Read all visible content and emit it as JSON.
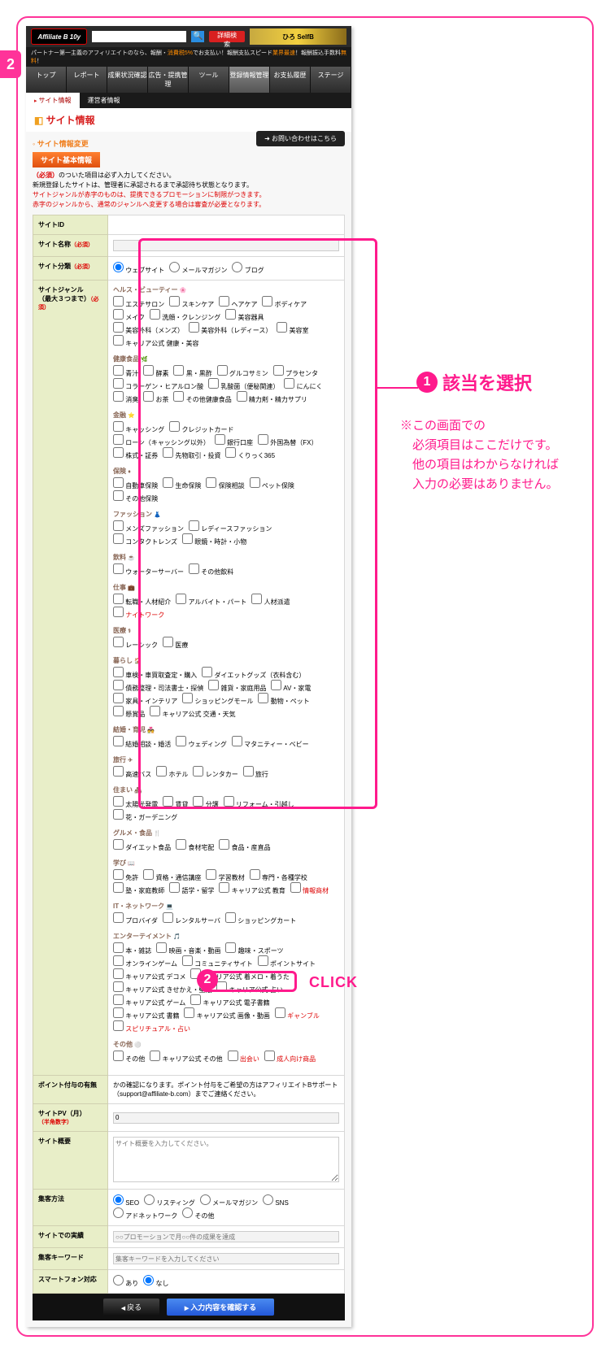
{
  "step_number": "2",
  "logo": "Affiliate B 10y",
  "tagline_plain": "パートナー第一主義のアフィリエイトのなら、報酬・",
  "tagline_highlight": "消費税5%",
  "tagline_plain2": "でお支払い！報酬支払スピード",
  "tagline_highlight2": "業界最速",
  "tagline_plain3": "！報酬振込手数料",
  "tagline_highlight3": "無料",
  "tagline_plain4": "！",
  "search_button": "詳細検索",
  "banner_text": "ひろ SelfB",
  "menu": [
    "トップ",
    "レポート",
    "成果状況確認",
    "広告・提携管理",
    "ツール",
    "登録情報管理",
    "お支払履歴",
    "ステージ"
  ],
  "sub_tabs": [
    "サイト情報",
    "運営者情報"
  ],
  "page_title": "サイト情報",
  "section_title": "サイト情報変更",
  "orange_bar": "サイト基本情報",
  "contact_btn": "お問い合わせはこちら",
  "notice_line1a": "（必須）",
  "notice_line1b": "のついた項目は必ず入力してください。",
  "notice_line2": "新規登録したサイトは、管理者に承認されるまで承認待ち状態となります。",
  "notice_line3": "サイトジャンルが赤字のものは、提携できるプロモーションに制限がつきます。",
  "notice_line4": "赤字のジャンルから、通常のジャンルへ変更する場合は審査が必要となります。",
  "rows": {
    "site_id": "サイトID",
    "site_name": "サイト名称",
    "site_type": "サイト分類",
    "site_genre": "サイトジャンル",
    "site_genre_sub": "（最大３つまで）",
    "point_grant": "ポイント付与の有無",
    "site_pv": "サイトPV（月）",
    "site_pv_sub": "（半角数字）",
    "site_summary": "サイト概要",
    "gather": "集客方法",
    "performance": "サイトでの実績",
    "keywords": "集客キーワード",
    "smartphone": "スマートフォン対応"
  },
  "required": "（必須）",
  "site_type_opts": [
    "ウェブサイト",
    "メールマガジン",
    "ブログ"
  ],
  "categories": [
    {
      "name": "ヘルス・ビューティー",
      "star": "🌸",
      "items": [
        "エステサロン",
        "スキンケア",
        "ヘアケア",
        "ボディケア",
        "メイク",
        "洗顔・クレンジング",
        "美容器具",
        "美容外科（メンズ）",
        "美容外科（レディース）",
        "美容室",
        "キャリア公式 健康・美容"
      ]
    },
    {
      "name": "健康食品",
      "star": "🌿",
      "items": [
        "青汁",
        "酵素",
        "黒・黒酢",
        "グルコサミン",
        "プラセンタ",
        "コラーゲン・ヒアルロン酸",
        "乳酸菌（便秘関連）",
        "にんにく",
        "消臭",
        "お茶",
        "その他健康食品",
        "精力剤・精力サプリ"
      ]
    },
    {
      "name": "金融",
      "star": "⭐",
      "items": [
        "キャッシング",
        "クレジットカード",
        "ローン（キャッシング以外）",
        "銀行口座",
        "外国為替（FX）",
        "株式・証券",
        "先物取引・投資",
        "くりっく365"
      ]
    },
    {
      "name": "保険",
      "star": "♦",
      "items": [
        "自動車保険",
        "生命保険",
        "保険相談",
        "ペット保険",
        "その他保険"
      ]
    },
    {
      "name": "ファッション",
      "star": "👗",
      "items": [
        "メンズファッション",
        "レディースファッション",
        "コンタクトレンズ",
        "眼鏡・時計・小物"
      ]
    },
    {
      "name": "飲料",
      "star": "☕",
      "items": [
        "ウォーターサーバー",
        "その他飲料"
      ]
    },
    {
      "name": "仕事",
      "star": "💼",
      "items": [
        "転職・人材紹介",
        "アルバイト・パート",
        "人材派遣"
      ],
      "red_items": [
        "ナイトワーク"
      ]
    },
    {
      "name": "医療",
      "star": "⚕",
      "items": [
        "レーシック",
        "医療"
      ]
    },
    {
      "name": "暮らし",
      "star": "🏠",
      "items": [
        "車検・車買取査定・購入",
        "ダイエットグッズ（衣料含む）",
        "債務整理・司法書士・探偵",
        "雑貨・家庭用品",
        "AV・家電",
        "家具・インテリア",
        "ショッピングモール",
        "動物・ペット",
        "懸賞品",
        "キャリア公式 交通・天気"
      ]
    },
    {
      "name": "結婚・育児",
      "star": "💑",
      "items": [
        "結婚相談・婚活",
        "ウェディング",
        "マタニティー・ベビー"
      ]
    },
    {
      "name": "旅行",
      "star": "✈",
      "items": [
        "高速バス",
        "ホテル",
        "レンタカー",
        "旅行"
      ]
    },
    {
      "name": "住まい",
      "star": "🏘",
      "items": [
        "太陽光発電",
        "賃貸",
        "分譲",
        "リフォーム・引越し",
        "花・ガーデニング"
      ]
    },
    {
      "name": "グルメ・食品",
      "star": "🍴",
      "items": [
        "ダイエット食品",
        "食材宅配",
        "食品・産直品"
      ]
    },
    {
      "name": "学び",
      "star": "📖",
      "items": [
        "免許",
        "資格・通信講座",
        "学習教材",
        "専門・各種学校",
        "塾・家庭教師",
        "語学・留学",
        "キャリア公式 教育"
      ],
      "red_items": [
        "情報商材"
      ]
    },
    {
      "name": "IT・ネットワーク",
      "star": "💻",
      "items": [
        "プロバイダ",
        "レンタルサーバ",
        "ショッピングカート"
      ]
    },
    {
      "name": "エンターテイメント",
      "star": "🎵",
      "items": [
        "本・雑誌",
        "映画・音楽・動画",
        "趣味・スポーツ",
        "オンラインゲーム",
        "コミュニティサイト",
        "ポイントサイト",
        "キャリア公式 デコメ",
        "キャリア公式 着メロ・着うた",
        "キャリア公式 きせかえ・壁紙",
        "キャリア公式 占い",
        "キャリア公式 ゲーム",
        "キャリア公式 電子書籍",
        "キャリア公式 書籍",
        "キャリア公式 画像・動画"
      ],
      "red_items": [
        "ギャンブル",
        "スピリチュアル・占い"
      ]
    },
    {
      "name": "その他",
      "star": "⚪",
      "items": [
        "その他",
        "キャリア公式 その他"
      ],
      "red_items": [
        "出会い",
        "成人向け商品"
      ]
    }
  ],
  "point_note": "かの確認になります。ポイント付与をご希望の方はアフィリエイトBサポート（support@affiliate-b.com）までご連絡ください。",
  "pv_value": "0",
  "summary_placeholder": "サイト概要を入力してください。",
  "gather_opts": [
    "SEO",
    "リスティング",
    "メールマガジン",
    "SNS",
    "アドネットワーク",
    "その他"
  ],
  "perf_placeholder": "○○プロモーションで月○○件の成果を達成",
  "kw_placeholder": "集客キーワードを入力してください",
  "sp_opts": [
    "あり",
    "なし"
  ],
  "btn_back": "戻る",
  "btn_confirm": "入力内容を確認する",
  "callout1": "該当を選択",
  "callout_note": "※この画面での\n　必須項目はここだけです。\n　他の項目はわからなければ\n　入力の必要はありません。",
  "click_label": "CLICK",
  "circ1": "1",
  "circ2": "2"
}
